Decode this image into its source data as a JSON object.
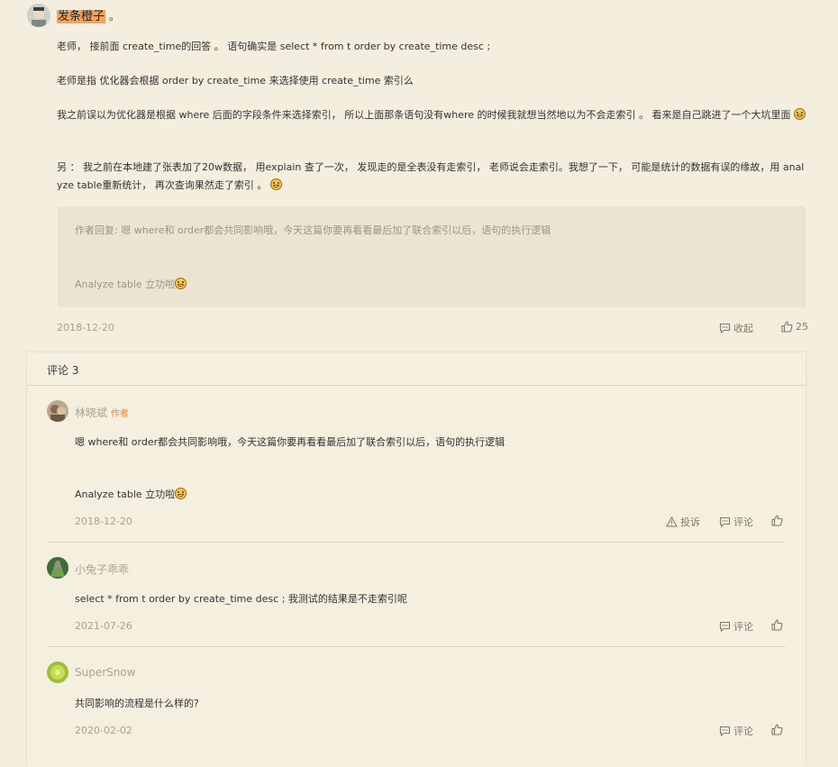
{
  "post": {
    "username": "发条橙子",
    "username_suffix": "。",
    "paragraphs": [
      "老师， 接前面 create_time的回答 。 语句确实是 select * from t order by create_time desc ;",
      "老师是指 优化器会根据 order by create_time 来选择使用 create_time 索引么",
      "我之前误以为优化器是根据 where 后面的字段条件来选择索引， 所以上面那条语句没有where 的时候我就想当然地以为不会走索引 。 看来是自己跳进了一个大坑里面",
      "另 ： 我之前在本地建了张表加了20w数据， 用explain 查了一次， 发现走的是全表没有走索引， 老师说会走索引。我想了一下， 可能是统计的数据有误的缘故，用 analyze table重新统计， 再次查询果然走了索引 。"
    ],
    "author_reply_line1": "作者回复: 嗯 where和 order都会共同影响哦，今天这篇你要再看看最后加了联合索引以后，语句的执行逻辑",
    "author_reply_line2": "Analyze table 立功啦",
    "date": "2018-12-20",
    "collapse_label": "收起",
    "like_count": "25"
  },
  "comments_section": {
    "title": "评论 3",
    "comments": [
      {
        "name": "林晓斌",
        "tag": "作者",
        "text_line1": "嗯 where和 order都会共同影响哦，今天这篇你要再看看最后加了联合索引以后，语句的执行逻辑",
        "text_line2": "Analyze table 立功啦",
        "date": "2018-12-20",
        "report_label": "投诉",
        "comment_label": "评论"
      },
      {
        "name": "小兔子乖乖",
        "text_line1": "select * from t order by create_time desc ; 我测试的结果是不走索引呢",
        "date": "2021-07-26",
        "comment_label": "评论"
      },
      {
        "name": "SuperSnow",
        "text_line1": "共同影响的流程是什么样的?",
        "date": "2020-02-02",
        "comment_label": "评论"
      }
    ]
  },
  "colors": {
    "page_background": "#f4eedf",
    "username_highlight": "#f3a35a",
    "reply_box": "#ebe4d0",
    "author_tag": "#e8843a"
  },
  "icons": [
    "smile-emoji-icon",
    "comment-icon",
    "thumbs-up-icon",
    "warning-icon"
  ]
}
